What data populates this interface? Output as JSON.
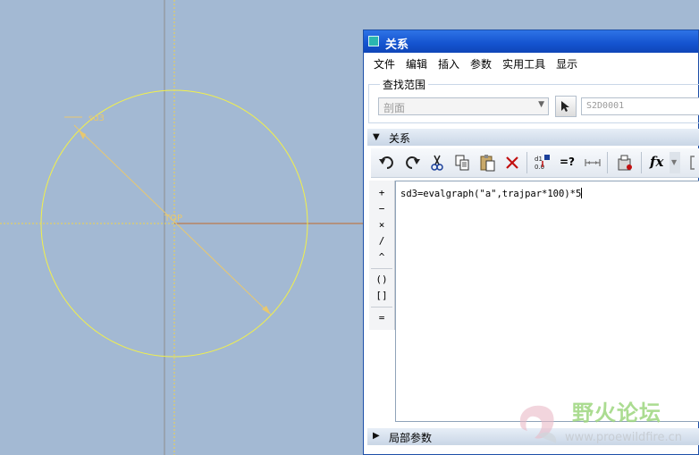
{
  "dialog": {
    "title": "关系"
  },
  "menu": [
    "文件",
    "编辑",
    "插入",
    "参数",
    "实用工具",
    "显示"
  ],
  "scope": {
    "label": "查找范围",
    "section_value": "剖面",
    "sketch_value": "S2D0001"
  },
  "relations_header": "关系",
  "toolbar": {
    "icons": [
      "undo-icon",
      "redo-icon",
      "cut-icon",
      "copy-icon",
      "paste-icon",
      "delete-icon",
      "show-dimensions-icon",
      "verify-icon",
      "sort-icon",
      "evaluate-icon",
      "function-icon"
    ],
    "verify_label": "=?",
    "function_label": "fx"
  },
  "operators": [
    "+",
    "−",
    "×",
    "/",
    "^",
    "()",
    "[]",
    "="
  ],
  "editor": {
    "text": "sd3=evalgraph(\"a\",trajpar*100)*5"
  },
  "local_params_header": "局部参数",
  "sketch": {
    "dim_label": "sd3",
    "plane_label": "TOP"
  },
  "watermark": {
    "title": "野火论坛",
    "url": "www.proewildfire.cn"
  },
  "colors": {
    "titlebar": "#1453cf",
    "sketch_bg": "#a3b9d3",
    "circle": "#f2f04a",
    "dimension": "#e8c870"
  }
}
